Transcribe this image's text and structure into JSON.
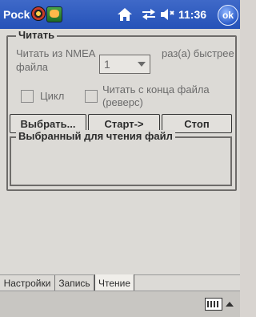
{
  "topbar": {
    "title": "Pock",
    "time": "11:36",
    "ok_label": "ok"
  },
  "group": {
    "title": "Читать",
    "read_label": "Читать из NMEA файла",
    "speed_value": "1",
    "times_label": "раз(а) быстрее",
    "cycle_label": "Цикл",
    "reverse_label": "Читать с конца файла (реверс)",
    "select_button": "Выбрать...",
    "start_button": "Старт->",
    "stop_button": "Стоп",
    "file_box_title": "Выбранный для чтения файл"
  },
  "tabs": [
    "Настройки",
    "Запись",
    "Чтение"
  ]
}
